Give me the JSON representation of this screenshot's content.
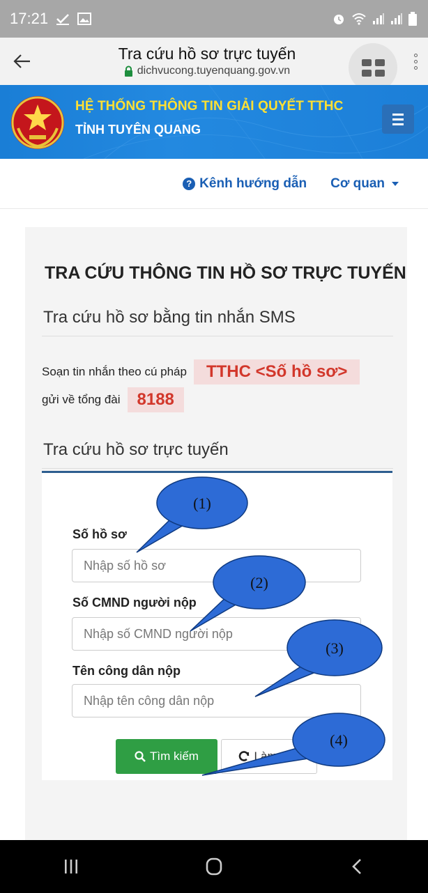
{
  "status_bar": {
    "time": "17:21",
    "left_icons": [
      "download-done-icon",
      "image-icon"
    ],
    "right_icons": [
      "alarm-icon",
      "wifi-icon",
      "signal-icon",
      "signal-icon",
      "battery-icon"
    ]
  },
  "browser": {
    "title": "Tra cứu hồ sơ trực tuyến",
    "url": "dichvucong.tuyenquang.gov.vn",
    "icons": [
      "back-arrow-icon",
      "lock-icon",
      "tabs-icon",
      "more-vert-icon"
    ]
  },
  "header": {
    "line1": "HỆ THỐNG THÔNG TIN GIẢI QUYẾT TTHC",
    "line2": "TỈNH TUYÊN QUANG",
    "colors": {
      "band": "#1c7fd8",
      "line1": "#ffe033"
    }
  },
  "nav": {
    "guide": "Kênh hướng dẫn",
    "agency": "Cơ quan"
  },
  "main": {
    "title": "TRA CỨU THÔNG TIN HỒ SƠ TRỰC TUYẾN",
    "sms": {
      "heading": "Tra cứu hồ sơ bằng tin nhắn SMS",
      "text1": "Soạn tin nhắn theo cú pháp",
      "code": "TTHC <Số hồ sơ>",
      "text2": "gửi về tổng đài",
      "number": "8188"
    },
    "online": {
      "heading": "Tra cứu hồ sơ trực tuyến",
      "fields": [
        {
          "label": "Số hồ sơ",
          "placeholder": "Nhập số hồ sơ"
        },
        {
          "label": "Số CMND người nộp",
          "placeholder": "Nhập số CMND người nộp"
        },
        {
          "label": "Tên công dân nộp",
          "placeholder": "Nhập tên công dân nộp"
        }
      ],
      "search_button": "Tìm kiếm",
      "reset_button": "Làm mới"
    }
  },
  "callouts": [
    "(1)",
    "(2)",
    "(3)",
    "(4)"
  ],
  "colors": {
    "accent_blue": "#1a5fb4",
    "highlight_red": "#d2372b",
    "highlight_bg": "#f4dcdc",
    "search_green": "#2f9e44",
    "callout_fill": "#2d6bd6"
  }
}
